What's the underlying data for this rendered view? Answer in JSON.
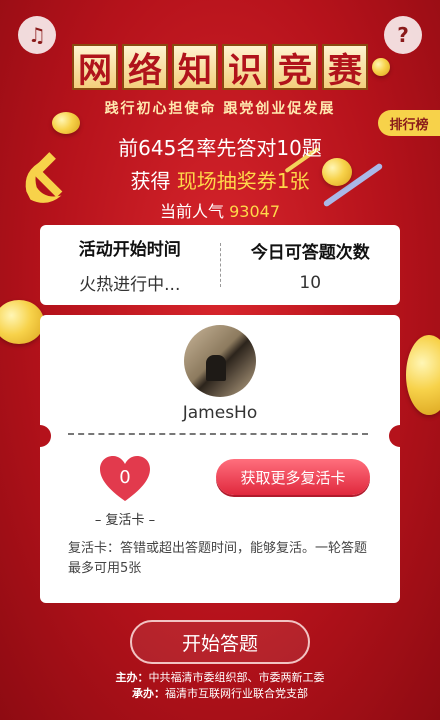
{
  "colors": {
    "primary": "#b5121b",
    "accent": "#ffd84a",
    "button": "#e0283d"
  },
  "header": {
    "title_chars": [
      "网",
      "络",
      "知",
      "识",
      "竞",
      "赛"
    ],
    "subtitle": "践行初心担使命  跟党创业促发展",
    "music_icon": "music-note-icon",
    "help_icon": "question-icon"
  },
  "rank_tag": "排行榜",
  "promo": {
    "line1": "前645名率先答对10题",
    "line2_prefix": "获得",
    "line2_highlight": "现场抽奖券1张",
    "line3_prefix": "当前人气",
    "line3_value": "93047"
  },
  "info": {
    "start_time_label": "活动开始时间",
    "start_time_value": "火热进行中...",
    "attempts_label": "今日可答题次数",
    "attempts_value": "10"
  },
  "profile": {
    "username": "JamesHo"
  },
  "revive": {
    "count": "0",
    "label": "– 复活卡 –",
    "more_button": "获取更多复活卡",
    "description": "复活卡：答错或超出答题时间，能够复活。一轮答题最多可用5张"
  },
  "start_button": "开始答题",
  "footer": {
    "host_label": "主办：",
    "host_value": "中共福清市委组织部、市委两新工委",
    "organizer_label": "承办：",
    "organizer_value": "福清市互联网行业联合党支部"
  }
}
